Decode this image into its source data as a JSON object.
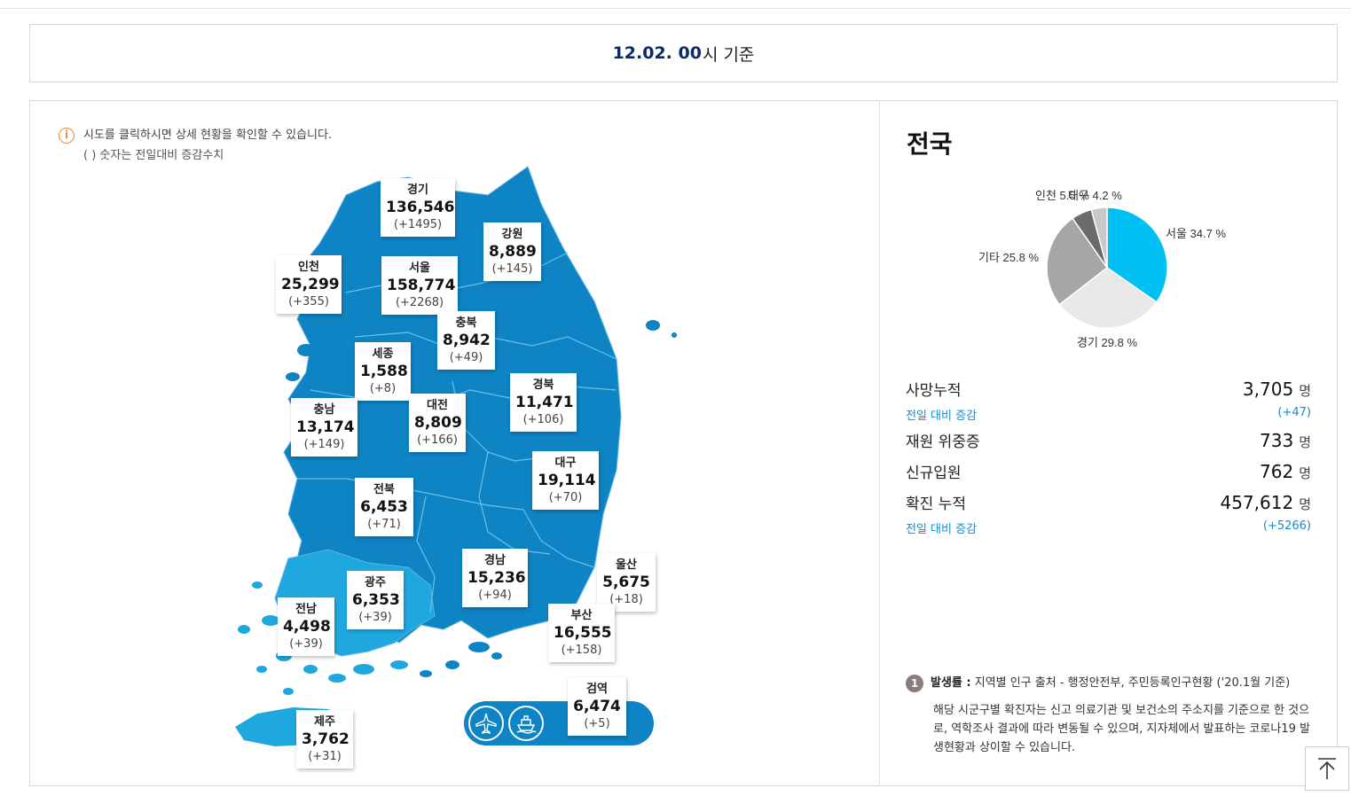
{
  "header": {
    "date_bold": "12.02. 00",
    "date_rest": "시 기준"
  },
  "notice": {
    "line1": "시도를 클릭하시면 상세 현황을 확인할 수 있습니다.",
    "line2": "( ) 숫자는 전일대비 증감수치",
    "icon": "info-icon"
  },
  "regions": [
    {
      "name": "경기",
      "count": "136,546",
      "diff": "(+1495)"
    },
    {
      "name": "강원",
      "count": "8,889",
      "diff": "(+145)"
    },
    {
      "name": "인천",
      "count": "25,299",
      "diff": "(+355)"
    },
    {
      "name": "서울",
      "count": "158,774",
      "diff": "(+2268)"
    },
    {
      "name": "충북",
      "count": "8,942",
      "diff": "(+49)"
    },
    {
      "name": "세종",
      "count": "1,588",
      "diff": "(+8)"
    },
    {
      "name": "경북",
      "count": "11,471",
      "diff": "(+106)"
    },
    {
      "name": "충남",
      "count": "13,174",
      "diff": "(+149)"
    },
    {
      "name": "대전",
      "count": "8,809",
      "diff": "(+166)"
    },
    {
      "name": "대구",
      "count": "19,114",
      "diff": "(+70)"
    },
    {
      "name": "전북",
      "count": "6,453",
      "diff": "(+71)"
    },
    {
      "name": "경남",
      "count": "15,236",
      "diff": "(+94)"
    },
    {
      "name": "울산",
      "count": "5,675",
      "diff": "(+18)"
    },
    {
      "name": "광주",
      "count": "6,353",
      "diff": "(+39)"
    },
    {
      "name": "전남",
      "count": "4,498",
      "diff": "(+39)"
    },
    {
      "name": "부산",
      "count": "16,555",
      "diff": "(+158)"
    },
    {
      "name": "검역",
      "count": "6,474",
      "diff": "(+5)"
    },
    {
      "name": "제주",
      "count": "3,762",
      "diff": "(+31)"
    }
  ],
  "transport_icons": [
    "airplane-icon",
    "ship-icon"
  ],
  "colors": {
    "map_main": "#0e84c5",
    "map_light": "#1fa8e0",
    "pie_seoul": "#00bff3",
    "pie_gyeonggi": "#e8e8e8",
    "pie_etc": "#a6a6a6",
    "pie_incheon": "#6b6b6b",
    "pie_other": "#c8c8c8",
    "accent_link": "#1a8bc6",
    "date_navy": "#0b2a6b"
  },
  "summary": {
    "title": "전국",
    "pie": {
      "slices": [
        {
          "label": "서울 34.7 %",
          "value": 34.7
        },
        {
          "label": "경기 29.8 %",
          "value": 29.8
        },
        {
          "label": "기타 25.8 %",
          "value": 25.8
        },
        {
          "label": "인천 5.5 %",
          "value": 5.5
        },
        {
          "label": "대구 4.2 %",
          "value": 4.2
        }
      ]
    },
    "death_label": "사망누적",
    "death_value": "3,705",
    "death_unit": "명",
    "death_diff_label": "전일 대비 증감",
    "death_diff": "(+47)",
    "severe_label": "재원 위중증",
    "severe_value": "733",
    "severe_unit": "명",
    "admit_label": "신규입원",
    "admit_value": "762",
    "admit_unit": "명",
    "confirmed_label": "확진 누적",
    "confirmed_value": "457,612",
    "confirmed_unit": "명",
    "confirmed_diff_label": "전일 대비 증감",
    "confirmed_diff": "(+5266)"
  },
  "footnote": {
    "number": "1",
    "bold": "발생률 :",
    "text": " 지역별 인구 출처 - 행정안전부, 주민등록인구현황 ('20.1월 기준)",
    "paragraph": "해당 시군구별 확진자는 신고 의료기관 및 보건소의 주소지를 기준으로 한 것으로, 역학조사 결과에 따라 변동될 수 있으며, 지자체에서 발표하는 코로나19 발생현황과 상이할 수 있습니다."
  },
  "to_top_icon": "arrow-up-icon"
}
